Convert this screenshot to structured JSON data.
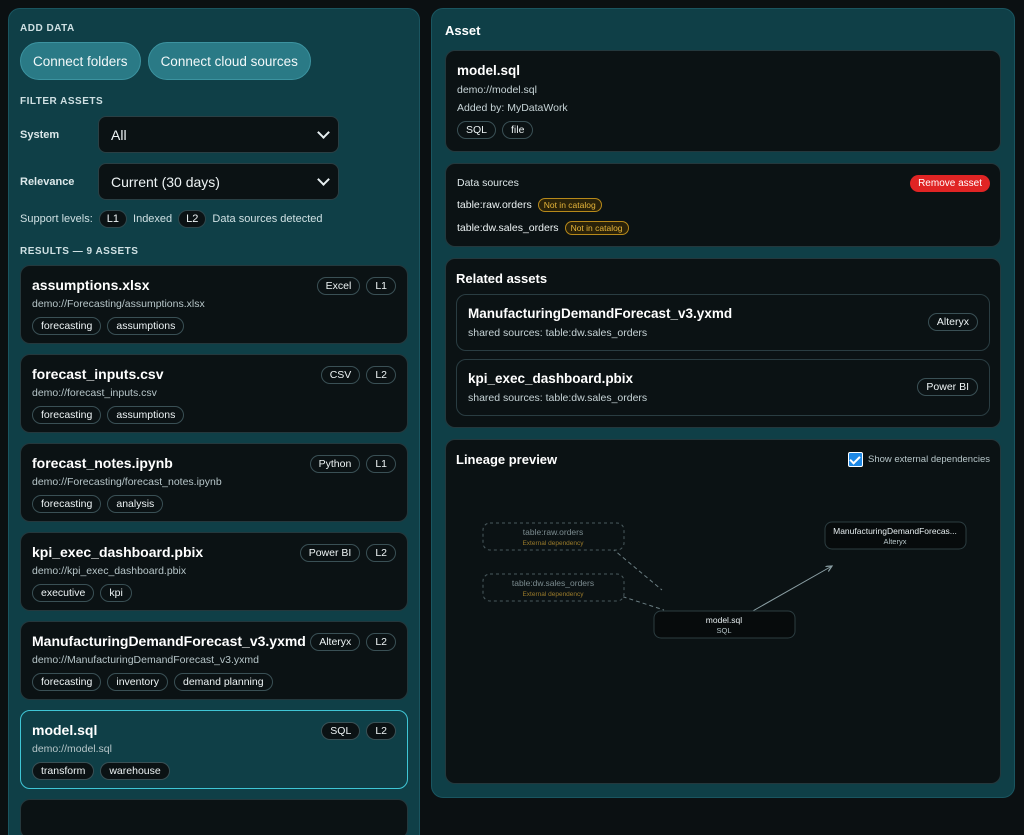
{
  "add_data": {
    "label": "ADD DATA",
    "connect_folders": "Connect folders",
    "connect_cloud": "Connect cloud sources"
  },
  "filter": {
    "label": "FILTER ASSETS",
    "system_label": "System",
    "system_value": "All",
    "relevance_label": "Relevance",
    "relevance_value": "Current (30 days)",
    "support_label": "Support levels:",
    "l1": "L1",
    "l1_text": "Indexed",
    "l2": "L2",
    "l2_text": "Data sources detected"
  },
  "results": {
    "label": "RESULTS — 9 ASSETS",
    "items": [
      {
        "name": "assumptions.xlsx",
        "path": "demo://Forecasting/assumptions.xlsx",
        "system": "Excel",
        "level": "L1",
        "tags": [
          "forecasting",
          "assumptions"
        ]
      },
      {
        "name": "forecast_inputs.csv",
        "path": "demo://forecast_inputs.csv",
        "system": "CSV",
        "level": "L2",
        "tags": [
          "forecasting",
          "assumptions"
        ]
      },
      {
        "name": "forecast_notes.ipynb",
        "path": "demo://Forecasting/forecast_notes.ipynb",
        "system": "Python",
        "level": "L1",
        "tags": [
          "forecasting",
          "analysis"
        ]
      },
      {
        "name": "kpi_exec_dashboard.pbix",
        "path": "demo://kpi_exec_dashboard.pbix",
        "system": "Power BI",
        "level": "L2",
        "tags": [
          "executive",
          "kpi"
        ]
      },
      {
        "name": "ManufacturingDemandForecast_v3.yxmd",
        "path": "demo://ManufacturingDemandForecast_v3.yxmd",
        "system": "Alteryx",
        "level": "L2",
        "tags": [
          "forecasting",
          "inventory",
          "demand planning"
        ]
      },
      {
        "name": "model.sql",
        "path": "demo://model.sql",
        "system": "SQL",
        "level": "L2",
        "tags": [
          "transform",
          "warehouse"
        ]
      }
    ]
  },
  "asset": {
    "heading": "Asset",
    "name": "model.sql",
    "path": "demo://model.sql",
    "added_by": "Added by: MyDataWork",
    "tags": [
      "SQL",
      "file"
    ]
  },
  "data_sources": {
    "title": "Data sources",
    "remove_label": "Remove asset",
    "items": [
      {
        "name": "table:raw.orders",
        "status": "Not in catalog"
      },
      {
        "name": "table:dw.sales_orders",
        "status": "Not in catalog"
      }
    ]
  },
  "related": {
    "title": "Related assets",
    "items": [
      {
        "name": "ManufacturingDemandForecast_v3.yxmd",
        "sub": "shared sources: table:dw.sales_orders",
        "system": "Alteryx"
      },
      {
        "name": "kpi_exec_dashboard.pbix",
        "sub": "shared sources: table:dw.sales_orders",
        "system": "Power BI"
      }
    ]
  },
  "lineage": {
    "title": "Lineage preview",
    "checkbox_label": "Show external dependencies",
    "checkbox_checked": true,
    "nodes": [
      {
        "id": "raw",
        "label": "table:raw.orders",
        "sub": "External dependency",
        "external": true
      },
      {
        "id": "dw",
        "label": "table:dw.sales_orders",
        "sub": "External dependency",
        "external": true
      },
      {
        "id": "model",
        "label": "model.sql",
        "sub": "SQL",
        "external": false
      },
      {
        "id": "mdf",
        "label": "ManufacturingDemandForecas...",
        "sub": "Alteryx",
        "external": false
      }
    ],
    "edges": [
      [
        "raw",
        "model"
      ],
      [
        "dw",
        "model"
      ],
      [
        "model",
        "mdf"
      ]
    ]
  },
  "colors": {
    "panel": "#0f3f47",
    "accent": "#3fc6d6",
    "danger": "#e02424",
    "warning": "#e7b53a"
  }
}
